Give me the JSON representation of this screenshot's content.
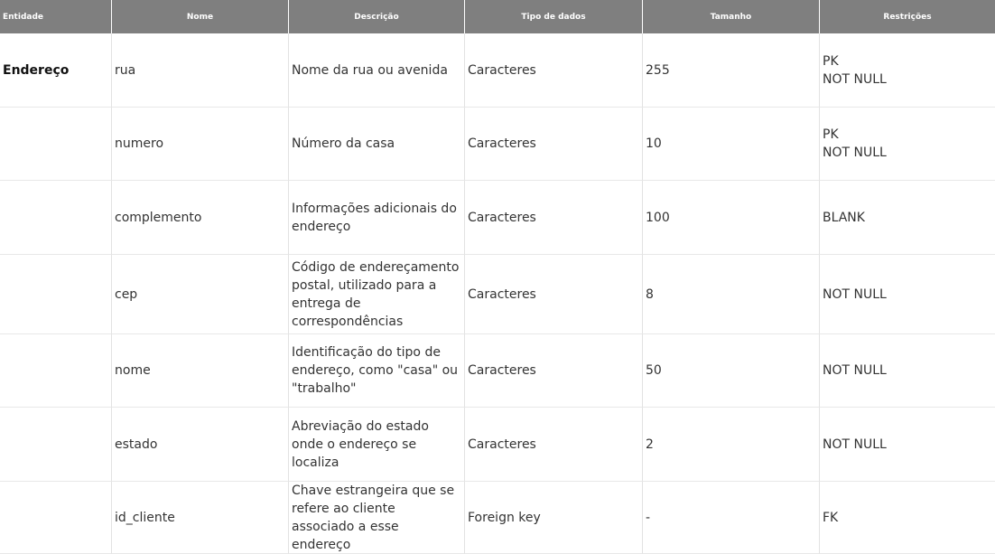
{
  "header": {
    "entidade": "Entidade",
    "nome": "Nome",
    "descricao": "Descrição",
    "tipo": "Tipo de dados",
    "tamanho": "Tamanho",
    "restricoes": "Restrições"
  },
  "rows": [
    {
      "entidade": "Endereço",
      "nome": "rua",
      "descricao": "Nome da rua ou avenida",
      "tipo": "Caracteres",
      "tamanho": "255",
      "restricoes": "PK\nNOT NULL"
    },
    {
      "entidade": "",
      "nome": "numero",
      "descricao": "Número da casa",
      "tipo": "Caracteres",
      "tamanho": "10",
      "restricoes": "PK\nNOT NULL"
    },
    {
      "entidade": "",
      "nome": "complemento",
      "descricao": "Informações adicionais do endereço",
      "tipo": "Caracteres",
      "tamanho": "100",
      "restricoes": "BLANK"
    },
    {
      "entidade": "",
      "nome": "cep",
      "descricao": "Código de endereçamento postal, utilizado para a entrega de correspondências",
      "tipo": "Caracteres",
      "tamanho": "8",
      "restricoes": "NOT NULL"
    },
    {
      "entidade": "",
      "nome": "nome",
      "descricao": "Identificação do tipo de endereço, como \"casa\" ou \"trabalho\"",
      "tipo": "Caracteres",
      "tamanho": "50",
      "restricoes": "NOT NULL"
    },
    {
      "entidade": "",
      "nome": "estado",
      "descricao": "Abreviação do estado onde o endereço se localiza",
      "tipo": "Caracteres",
      "tamanho": "2",
      "restricoes": "NOT NULL"
    },
    {
      "entidade": "",
      "nome": "id_cliente",
      "descricao": "Chave estrangeira que se refere ao cliente associado a esse endereço",
      "tipo": "Foreign key",
      "tamanho": "-",
      "restricoes": "FK"
    }
  ]
}
